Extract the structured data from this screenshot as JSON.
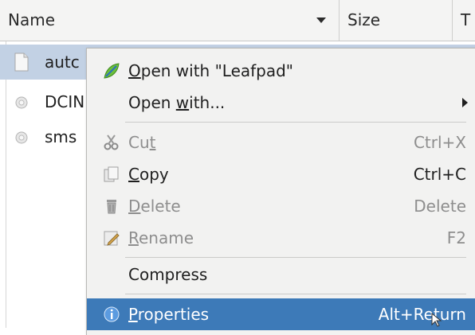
{
  "columns": {
    "name": "Name",
    "size": "Size",
    "type": "T"
  },
  "files": [
    {
      "name": "autc",
      "icon": "text-file-icon",
      "selected": true
    },
    {
      "name": "DCIN",
      "icon": "folder-icon",
      "selected": false
    },
    {
      "name": "sms",
      "icon": "folder-icon",
      "selected": false
    }
  ],
  "menu": {
    "open_with_leafpad": {
      "pre": "",
      "mn": "O",
      "post": "pen with \"Leafpad\"",
      "icon": "leafpad-icon"
    },
    "open_with": {
      "pre": "Open ",
      "mn": "w",
      "post": "ith...",
      "submenu": true
    },
    "cut": {
      "pre": "Cu",
      "mn": "t",
      "post": "",
      "accel": "Ctrl+X",
      "icon": "scissors-icon",
      "enabled": false
    },
    "copy": {
      "pre": "",
      "mn": "C",
      "post": "opy",
      "accel": "Ctrl+C",
      "icon": "copy-icon",
      "enabled": true
    },
    "delete": {
      "pre": "",
      "mn": "D",
      "post": "elete",
      "accel": "Delete",
      "icon": "trash-icon",
      "enabled": false
    },
    "rename": {
      "pre": "",
      "mn": "R",
      "post": "ename",
      "accel": "F2",
      "icon": "rename-icon",
      "enabled": false
    },
    "compress": {
      "label": "Compress"
    },
    "properties": {
      "pre": "",
      "mn": "P",
      "post": "roperties",
      "accel": "Alt+Return",
      "icon": "info-icon",
      "highlighted": true
    }
  },
  "colors": {
    "highlight": "#3d7ab8",
    "selected_row": "#c2d1e4",
    "disabled_text": "#8e8e8e"
  }
}
